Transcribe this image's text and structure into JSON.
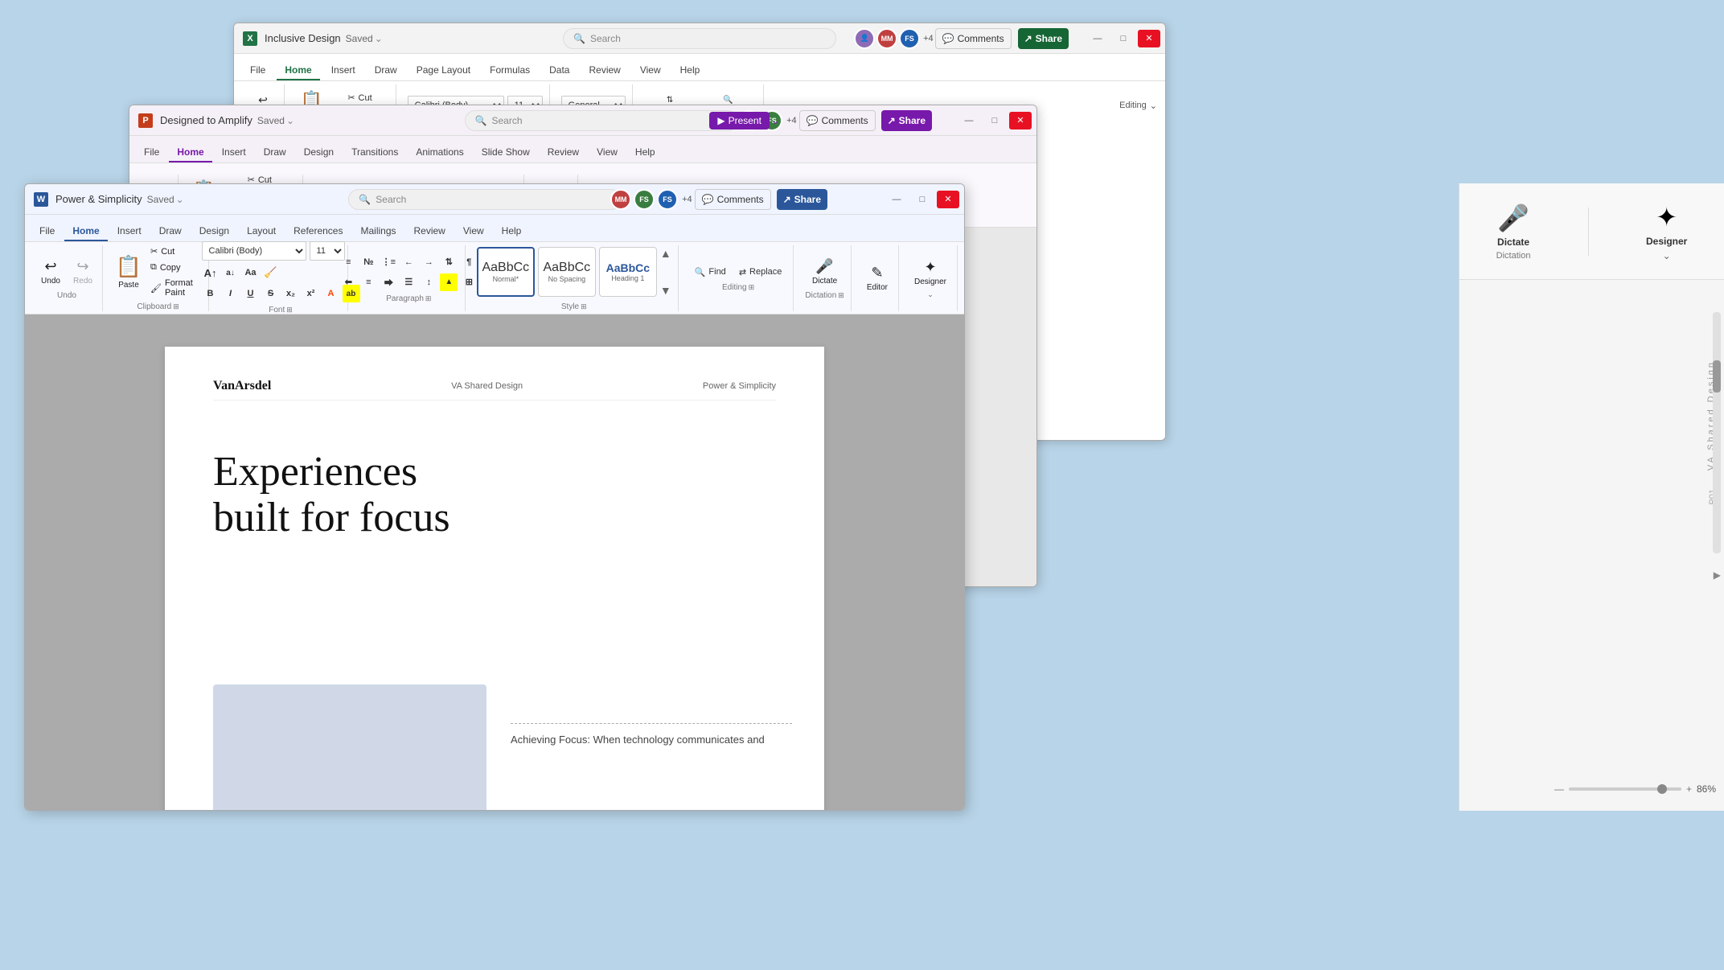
{
  "background": "#b8d4e8",
  "excel_window": {
    "title": "Inclusive Design",
    "saved": "Saved",
    "search_placeholder": "Search",
    "tabs": [
      "File",
      "Home",
      "Insert",
      "Draw",
      "Page Layout",
      "Formulas",
      "Data",
      "Review",
      "View",
      "Help"
    ],
    "active_tab": "Home",
    "users": [
      "MM",
      ""
    ],
    "plus_count": "+4",
    "comments_label": "Comments",
    "share_label": "Share",
    "undo_label": "Undo",
    "cut_label": "Cut"
  },
  "ppt_window": {
    "title": "Designed to Amplify",
    "saved": "Saved",
    "search_placeholder": "Search",
    "tabs": [
      "File",
      "Home",
      "Insert",
      "Draw",
      "Design",
      "Transitions",
      "Animations",
      "Slide Show",
      "Review",
      "View",
      "Help"
    ],
    "active_tab": "Home",
    "users_plus": "+4",
    "present_label": "Present",
    "comments_label": "Comments",
    "share_label": "Share"
  },
  "word_window": {
    "title": "Power & Simplicity",
    "saved": "Saved",
    "search_placeholder": "Search",
    "tabs": [
      "File",
      "Home",
      "Insert",
      "Draw",
      "Design",
      "Layout",
      "References",
      "Mailings",
      "Review",
      "View",
      "Help"
    ],
    "active_tab": "Home",
    "users_plus": "+4",
    "comments_label": "Comments",
    "share_label": "Share",
    "ribbon": {
      "undo": "Undo",
      "redo": "Redo",
      "paste": "Paste",
      "cut": "Cut",
      "copy": "Copy",
      "format_paint": "Format Paint",
      "clipboard_label": "Clipboard",
      "font_name": "Calibri (Body)",
      "font_size": "11",
      "font_label": "Font",
      "paragraph_label": "Paragraph",
      "style_normal": "Normal*",
      "style_nospacing": "No Spacing",
      "style_heading": "Heading 1",
      "style_label": "Style",
      "find_label": "Find",
      "replace_label": "Replace",
      "editing_label": "Editing",
      "dictate_label": "Dictate",
      "dictation_label": "Dictation",
      "editor_label": "Editor",
      "designer_label": "Designer"
    },
    "doc": {
      "logo": "VanArsdel",
      "shared_design": "VA Shared Design",
      "section": "Power & Simplicity",
      "main_heading_line1": "Experiences",
      "main_heading_line2": "built for focus",
      "body_text": "Achieving Focus: When technology communicates and",
      "dot_label": "·"
    }
  },
  "right_panel": {
    "dictate_label": "Dictate",
    "dictation_sub": "Dictation",
    "designer_label": "Designer",
    "shared_design_vertical": "VA Shared Design",
    "p01_label": "P01",
    "scroll_zoom": "86%"
  },
  "icons": {
    "search": "🔍",
    "undo": "↩",
    "redo": "↪",
    "paste": "📋",
    "cut": "✂",
    "copy": "⧉",
    "format_paint": "🖌",
    "bold": "B",
    "italic": "I",
    "underline": "U",
    "strikethrough": "S",
    "font_grow": "A",
    "font_shrink": "a",
    "bullets": "≡",
    "numbering": "№",
    "indent": "→",
    "align_left": "⬅",
    "find": "🔍",
    "replace": "⇄",
    "dictate": "🎤",
    "designer": "✦",
    "editor": "✎",
    "minimize": "—",
    "maximize": "□",
    "close": "✕",
    "chevron_down": "⌄"
  }
}
